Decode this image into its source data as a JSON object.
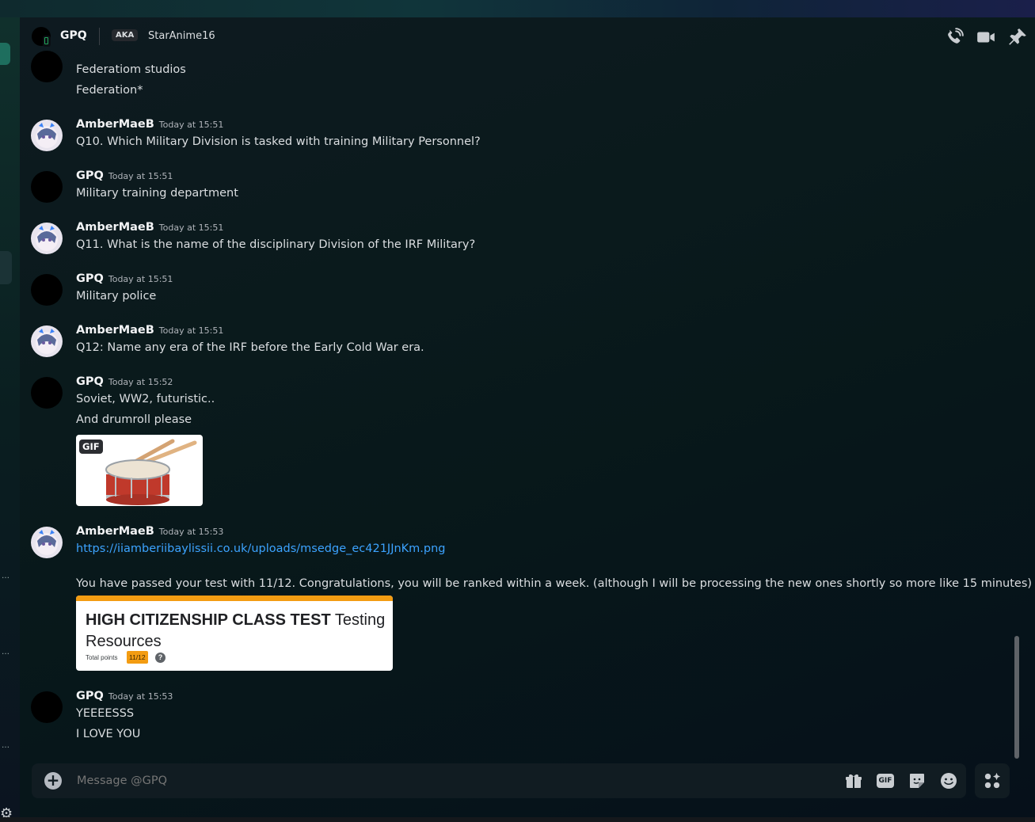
{
  "header": {
    "name": "GPQ",
    "aka_label": "AKA",
    "alias": "StarAnime16",
    "icons": [
      "voice-call-icon",
      "video-call-icon",
      "pin-icon"
    ]
  },
  "messages": [
    {
      "author": "",
      "timestamp": "",
      "lines": [
        "Federatiom studios",
        "Federation*"
      ],
      "partial": true
    },
    {
      "author": "AmberMaeB",
      "timestamp": "Today at 15:51",
      "lines": [
        "Q10. Which Military Division is tasked with training Military Personnel?"
      ]
    },
    {
      "author": "GPQ",
      "timestamp": "Today at 15:51",
      "lines": [
        "Military training department"
      ]
    },
    {
      "author": "AmberMaeB",
      "timestamp": "Today at 15:51",
      "lines": [
        "Q11. What is the name of the disciplinary Division of the IRF Military?"
      ]
    },
    {
      "author": "GPQ",
      "timestamp": "Today at 15:51",
      "lines": [
        "Military police"
      ]
    },
    {
      "author": "AmberMaeB",
      "timestamp": "Today at 15:51",
      "lines": [
        "Q12: Name any era of the IRF before the Early Cold War era."
      ]
    },
    {
      "author": "GPQ",
      "timestamp": "Today at 15:52",
      "lines": [
        "Soviet, WW2, futuristic..",
        "And drumroll please"
      ],
      "gif_label": "GIF"
    },
    {
      "author": "AmberMaeB",
      "timestamp": "Today at 15:53",
      "link": "https://iiamberiibaylissii.co.uk/uploads/msedge_ec421JJnKm.png",
      "lines": [
        "You have passed your test with 11/12. Congratulations, you will be ranked within a week. (although I will be processing the new ones shortly so more like 15 minutes)"
      ]
    },
    {
      "author": "GPQ",
      "timestamp": "Today at 15:53",
      "lines": [
        "YEEEESSS",
        "I LOVE YOU"
      ]
    }
  ],
  "result_card": {
    "title_bold": "HIGH CITIZENSHIP CLASS TEST",
    "title_rest": "Testing Resources",
    "points_label": "Total points",
    "score": "11/12",
    "help": "?",
    "bar_color": "#f39c12"
  },
  "composer": {
    "placeholder": "Message @GPQ",
    "gif_label": "GIF"
  },
  "colors": {
    "link": "#3ca3ff",
    "online": "#23a55a"
  }
}
